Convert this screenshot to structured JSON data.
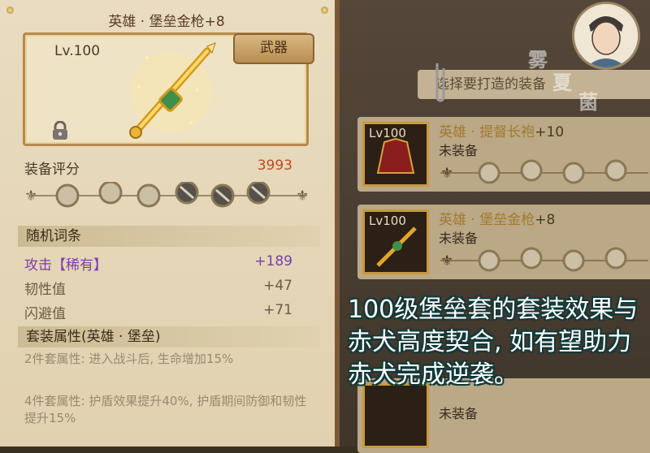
{
  "detail": {
    "title": "英雄 · 堡垒金枪+8",
    "level": "Lv.100",
    "category": "武器",
    "score_label": "装备评分",
    "score_value": "3993",
    "random_header": "随机词条",
    "stats": [
      {
        "name": "攻击【稀有】",
        "value": "+189",
        "color": "#7a3fa8"
      },
      {
        "name": "韧性值",
        "value": "+47",
        "color": "#6a5a48"
      },
      {
        "name": "闪避值",
        "value": "+71",
        "color": "#6a5a48"
      }
    ],
    "set_header": "套装属性(英雄 · 堡垒)",
    "set_bonus_2": "2件套属性: 进入战斗后, 生命增加15%",
    "set_bonus_4": "4件套属性: 护盾效果提升40%, 护盾期间防御和韧性提升15%"
  },
  "list": {
    "header": "选择要打造的装备",
    "items": [
      {
        "level": "Lv100",
        "name": "英雄 · 提督长袍",
        "plus": "+10",
        "state": "未装备",
        "icon": "robe-icon"
      },
      {
        "level": "Lv100",
        "name": "英雄 · 堡垒金枪",
        "plus": "+8",
        "state": "未装备",
        "icon": "spear-icon"
      },
      {
        "level": "",
        "name": "",
        "plus": "",
        "state": "未装备",
        "icon": "armor-icon"
      }
    ]
  },
  "watermark": [
    "雾",
    "夏",
    "菌"
  ],
  "caption": "100级堡垒套的套装效果与赤犬高度契合, 如有望助力赤犬完成逆袭。",
  "colors": {
    "accent_gold": "#c79a3c",
    "score_red": "#c04a24",
    "rare_purple": "#7a3fa8"
  }
}
